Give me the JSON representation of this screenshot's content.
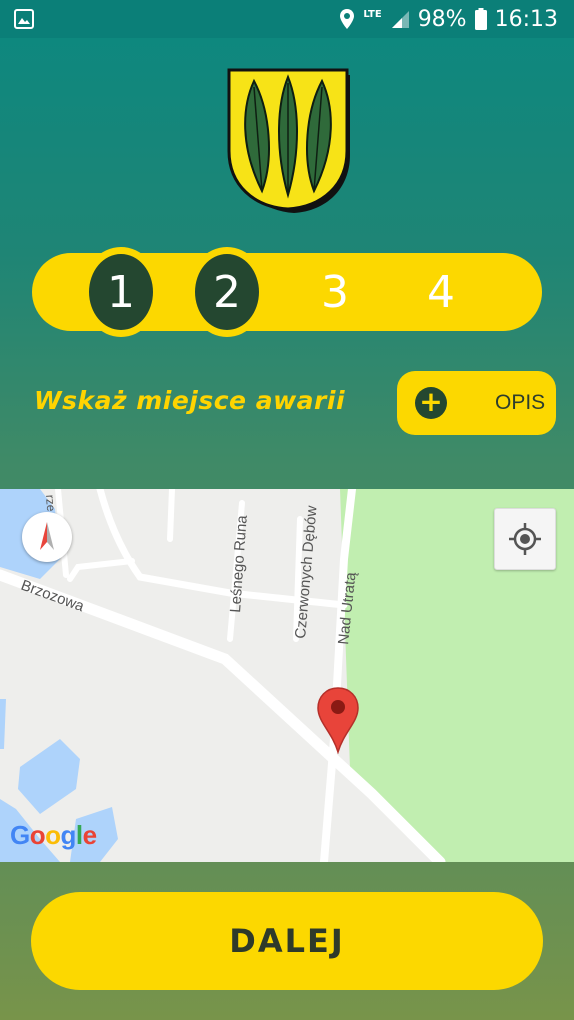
{
  "status_bar": {
    "network": "LTE",
    "battery": "98%",
    "time": "16:13"
  },
  "stepper": {
    "steps": [
      "1",
      "2",
      "3",
      "4"
    ],
    "completed": 2
  },
  "header": {
    "title": "Wskaż miejsce awarii",
    "opis_button": {
      "icon": "plus-icon",
      "label": "OPIS"
    }
  },
  "map": {
    "streets": [
      "Brzozowa",
      "Leśnego Runa",
      "Czerwonych Dębów",
      "Nad Utratą"
    ],
    "partial_label": "rze",
    "google_logo": "Google"
  },
  "footer": {
    "next_label": "DALEJ"
  },
  "colors": {
    "accent_yellow": "#fcd800",
    "dark_green": "#244730",
    "teal_top": "#0b8880"
  }
}
